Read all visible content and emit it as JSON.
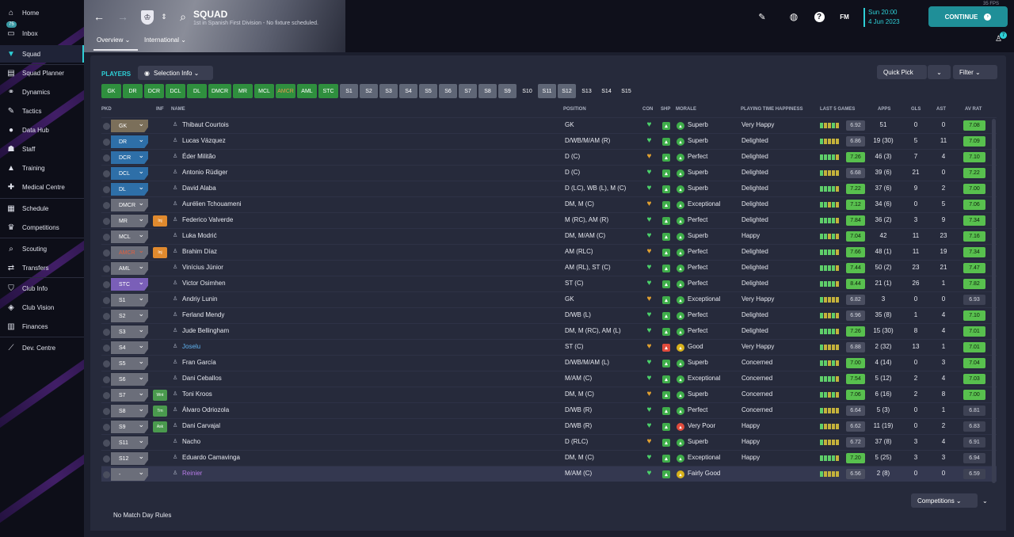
{
  "nav": {
    "items": [
      {
        "label": "Home",
        "icon": "home-icon"
      },
      {
        "label": "Inbox",
        "icon": "inbox-icon",
        "badge": "75"
      },
      {
        "label": "Squad",
        "icon": "shirt-icon"
      },
      {
        "label": "Squad Planner",
        "icon": "clipboard-icon"
      },
      {
        "label": "Dynamics",
        "icon": "dynamics-icon"
      },
      {
        "label": "Tactics",
        "icon": "tactics-icon"
      },
      {
        "label": "Data Hub",
        "icon": "data-hub-icon"
      },
      {
        "label": "Staff",
        "icon": "staff-icon"
      },
      {
        "label": "Training",
        "icon": "training-icon"
      },
      {
        "label": "Medical Centre",
        "icon": "medical-icon"
      },
      {
        "label": "Schedule",
        "icon": "calendar-icon"
      },
      {
        "label": "Competitions",
        "icon": "trophy-icon"
      },
      {
        "label": "Scouting",
        "icon": "scouting-icon"
      },
      {
        "label": "Transfers",
        "icon": "transfers-icon"
      },
      {
        "label": "Club Info",
        "icon": "shield-icon"
      },
      {
        "label": "Club Vision",
        "icon": "vision-icon"
      },
      {
        "label": "Finances",
        "icon": "finances-icon"
      },
      {
        "label": "Dev. Centre",
        "icon": "dev-centre-icon"
      }
    ]
  },
  "header": {
    "title": "SQUAD",
    "subtitle": "1st in Spanish First Division - No fixture scheduled.",
    "tabs": [
      "Overview ⌄",
      "International ⌄"
    ],
    "date_line1": "Sun 20:00",
    "date_line2": "4 Jun 2023",
    "continue": "CONTINUE",
    "fm": "FM",
    "fps": "35 FPS",
    "user_badge": "7"
  },
  "players": {
    "title": "PLAYERS",
    "selection_info": "Selection Info ⌄",
    "quick_pick": "Quick Pick",
    "filter": "Filter ⌄"
  },
  "chips": [
    "GK",
    "DR",
    "DCR",
    "DCL",
    "DL",
    "DMCR",
    "MR",
    "MCL",
    "AMCR",
    "AML",
    "STC",
    "S1",
    "S2",
    "S3",
    "S4",
    "S5",
    "S6",
    "S7",
    "S8",
    "S9",
    "S10",
    "S11",
    "S12",
    "S13",
    "S14",
    "S15"
  ],
  "columns": {
    "pkd": "PKD",
    "inf": "INF",
    "name": "NAME",
    "position": "POSITION",
    "con": "CON",
    "shp": "SHP",
    "morale": "MORALE",
    "happiness": "PLAYING TIME HAPPINESS",
    "last5": "LAST 5 GAMES",
    "apps": "APPS",
    "gls": "GLS",
    "ast": "AST",
    "avrat": "AV RAT"
  },
  "rows": [
    {
      "slot": "GK",
      "inf": "",
      "name": "Thibaut Courtois",
      "pos": "GK",
      "morale": "Superb",
      "happy": "Very Happy",
      "l5": "6.92",
      "apps": "51",
      "gls": "0",
      "ast": "0",
      "av": "7.08"
    },
    {
      "slot": "DR",
      "inf": "",
      "name": "Lucas Vázquez",
      "pos": "D/WB/M/AM (R)",
      "morale": "Superb",
      "happy": "Delighted",
      "l5": "6.86",
      "apps": "19 (30)",
      "gls": "5",
      "ast": "11",
      "av": "7.09"
    },
    {
      "slot": "DCR",
      "inf": "",
      "name": "Éder Militão",
      "pos": "D (C)",
      "morale": "Perfect",
      "happy": "Delighted",
      "l5": "7.26",
      "apps": "46 (3)",
      "gls": "7",
      "ast": "4",
      "av": "7.10"
    },
    {
      "slot": "DCL",
      "inf": "",
      "name": "Antonio Rüdiger",
      "pos": "D (C)",
      "morale": "Superb",
      "happy": "Delighted",
      "l5": "6.68",
      "apps": "39 (6)",
      "gls": "21",
      "ast": "0",
      "av": "7.22"
    },
    {
      "slot": "DL",
      "inf": "",
      "name": "David Alaba",
      "pos": "D (LC), WB (L), M (C)",
      "morale": "Superb",
      "happy": "Delighted",
      "l5": "7.22",
      "apps": "37 (6)",
      "gls": "9",
      "ast": "2",
      "av": "7.00"
    },
    {
      "slot": "DMCR",
      "inf": "",
      "name": "Aurélien Tchouameni",
      "pos": "DM, M (C)",
      "morale": "Exceptional",
      "happy": "Delighted",
      "l5": "7.12",
      "apps": "34 (6)",
      "gls": "0",
      "ast": "5",
      "av": "7.06"
    },
    {
      "slot": "MR",
      "inf": "Inj",
      "name": "Federico Valverde",
      "pos": "M (RC), AM (R)",
      "morale": "Perfect",
      "happy": "Delighted",
      "l5": "7.84",
      "apps": "36 (2)",
      "gls": "3",
      "ast": "9",
      "av": "7.34"
    },
    {
      "slot": "MCL",
      "inf": "",
      "name": "Luka Modrić",
      "pos": "DM, M/AM (C)",
      "morale": "Superb",
      "happy": "Happy",
      "l5": "7.04",
      "apps": "42",
      "gls": "11",
      "ast": "23",
      "av": "7.16"
    },
    {
      "slot": "AMCR",
      "inf": "Inj",
      "name": "Brahim Díaz",
      "pos": "AM (RLC)",
      "morale": "Perfect",
      "happy": "Delighted",
      "l5": "7.66",
      "apps": "48 (1)",
      "gls": "11",
      "ast": "19",
      "av": "7.34"
    },
    {
      "slot": "AML",
      "inf": "",
      "name": "Vinícius Júnior",
      "pos": "AM (RL), ST (C)",
      "morale": "Perfect",
      "happy": "Delighted",
      "l5": "7.44",
      "apps": "50 (2)",
      "gls": "23",
      "ast": "21",
      "av": "7.47"
    },
    {
      "slot": "STC",
      "inf": "",
      "name": "Victor Osimhen",
      "pos": "ST (C)",
      "morale": "Perfect",
      "happy": "Delighted",
      "l5": "8.44",
      "apps": "21 (1)",
      "gls": "26",
      "ast": "1",
      "av": "7.82"
    },
    {
      "slot": "S1",
      "inf": "",
      "name": "Andriy Lunin",
      "pos": "GK",
      "morale": "Exceptional",
      "happy": "Very Happy",
      "l5": "6.82",
      "apps": "3",
      "gls": "0",
      "ast": "0",
      "av": "6.93"
    },
    {
      "slot": "S2",
      "inf": "",
      "name": "Ferland Mendy",
      "pos": "D/WB (L)",
      "morale": "Perfect",
      "happy": "Delighted",
      "l5": "6.96",
      "apps": "35 (8)",
      "gls": "1",
      "ast": "4",
      "av": "7.10"
    },
    {
      "slot": "S3",
      "inf": "",
      "name": "Jude Bellingham",
      "pos": "DM, M (RC), AM (L)",
      "morale": "Perfect",
      "happy": "Delighted",
      "l5": "7.26",
      "apps": "15 (30)",
      "gls": "8",
      "ast": "4",
      "av": "7.01"
    },
    {
      "slot": "S4",
      "inf": "",
      "name": "Joselu",
      "pos": "ST (C)",
      "morale": "Good",
      "happy": "Very Happy",
      "l5": "6.88",
      "apps": "2 (32)",
      "gls": "13",
      "ast": "1",
      "av": "7.01"
    },
    {
      "slot": "S5",
      "inf": "",
      "name": "Fran García",
      "pos": "D/WB/M/AM (L)",
      "morale": "Superb",
      "happy": "Concerned",
      "l5": "7.00",
      "apps": "4 (14)",
      "gls": "0",
      "ast": "3",
      "av": "7.04"
    },
    {
      "slot": "S6",
      "inf": "",
      "name": "Dani Ceballos",
      "pos": "M/AM (C)",
      "morale": "Exceptional",
      "happy": "Concerned",
      "l5": "7.54",
      "apps": "5 (12)",
      "gls": "2",
      "ast": "4",
      "av": "7.03"
    },
    {
      "slot": "S7",
      "inf": "Wnt",
      "name": "Toni Kroos",
      "pos": "DM, M (C)",
      "morale": "Superb",
      "happy": "Concerned",
      "l5": "7.06",
      "apps": "6 (16)",
      "gls": "2",
      "ast": "8",
      "av": "7.00"
    },
    {
      "slot": "S8",
      "inf": "Trn",
      "name": "Álvaro Odriozola",
      "pos": "D/WB (R)",
      "morale": "Perfect",
      "happy": "Concerned",
      "l5": "6.64",
      "apps": "5 (3)",
      "gls": "0",
      "ast": "1",
      "av": "6.81"
    },
    {
      "slot": "S9",
      "inf": "Ask",
      "name": "Dani Carvajal",
      "pos": "D/WB (R)",
      "morale": "Very Poor",
      "happy": "Happy",
      "l5": "6.62",
      "apps": "11 (19)",
      "gls": "0",
      "ast": "2",
      "av": "6.83"
    },
    {
      "slot": "S11",
      "inf": "",
      "name": "Nacho",
      "pos": "D (RLC)",
      "morale": "Superb",
      "happy": "Happy",
      "l5": "6.72",
      "apps": "37 (8)",
      "gls": "3",
      "ast": "4",
      "av": "6.91"
    },
    {
      "slot": "S12",
      "inf": "",
      "name": "Eduardo Camavinga",
      "pos": "DM, M (C)",
      "morale": "Exceptional",
      "happy": "Happy",
      "l5": "7.20",
      "apps": "5 (25)",
      "gls": "3",
      "ast": "3",
      "av": "6.94"
    },
    {
      "slot": "-",
      "inf": "",
      "name": "Reinier",
      "pos": "M/AM (C)",
      "morale": "Fairly Good",
      "happy": "",
      "l5": "6.56",
      "apps": "2 (8)",
      "gls": "0",
      "ast": "0",
      "av": "6.59"
    }
  ],
  "footer": {
    "no_rules": "No Match Day Rules",
    "competitions": "Competitions ⌄"
  }
}
